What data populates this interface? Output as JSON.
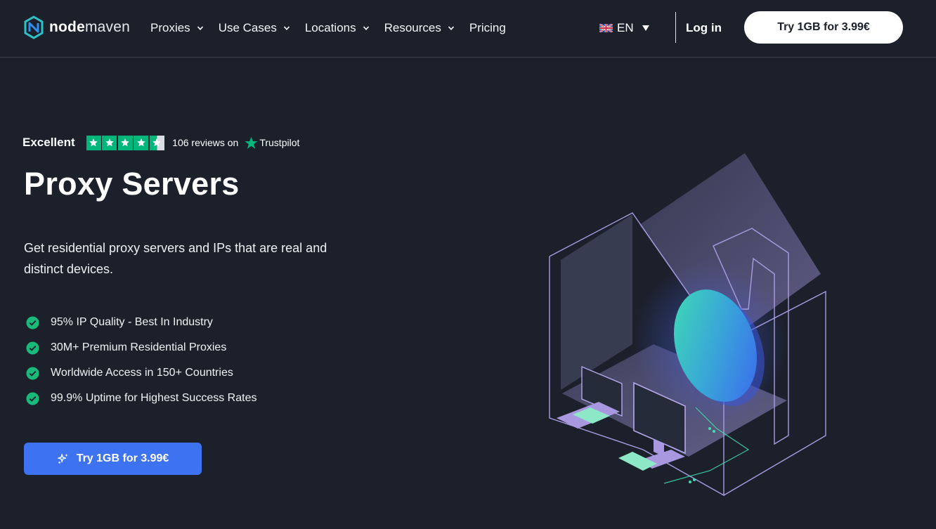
{
  "brand": {
    "name_bold": "node",
    "name_light": "maven"
  },
  "nav": {
    "items": [
      {
        "label": "Proxies",
        "has_dropdown": true
      },
      {
        "label": "Use Cases",
        "has_dropdown": true
      },
      {
        "label": "Locations",
        "has_dropdown": true
      },
      {
        "label": "Resources",
        "has_dropdown": true
      },
      {
        "label": "Pricing",
        "has_dropdown": false
      }
    ]
  },
  "header": {
    "language": "EN",
    "login_label": "Log in",
    "cta_label": "Try 1GB for 3.99€"
  },
  "trustpilot": {
    "rating_word": "Excellent",
    "stars": 4.5,
    "reviews_text": "106 reviews on",
    "brand": "Trustpilot"
  },
  "hero": {
    "title": "Proxy Servers",
    "subtitle": "Get residential proxy servers and IPs that are real and distinct devices.",
    "features": [
      "95% IP Quality - Best In Industry",
      "30M+ Premium Residential Proxies",
      "Worldwide Access in 150+ Countries",
      "99.9% Uptime for Highest Success Rates"
    ],
    "cta_label": "Try 1GB for 3.99€"
  },
  "colors": {
    "background": "#1b202b",
    "accent_blue": "#3d73f0",
    "trustpilot_green": "#00b67a",
    "check_green": "#19b97a"
  },
  "icons": {
    "logo": "nodemaven-logo-icon",
    "chevron": "chevron-down-icon",
    "check": "check-circle-icon",
    "sparkle": "sparkle-icon"
  }
}
